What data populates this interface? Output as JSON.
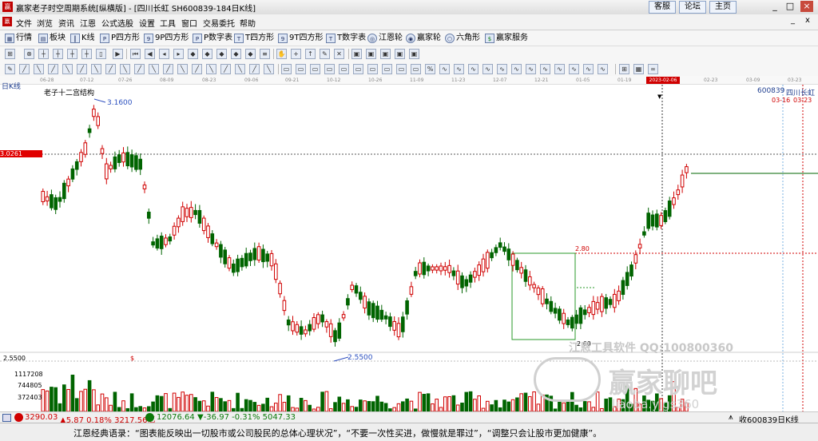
{
  "window": {
    "title": "赢家老子时空周期系统[纵横版] - [四川长虹  SH600839-184日K线]",
    "top_buttons": [
      "客服",
      "论坛",
      "主页"
    ],
    "win_controls": [
      "_",
      "□",
      "×"
    ],
    "sub_controls": [
      "_",
      "x"
    ]
  },
  "menu": [
    "文件",
    "浏览",
    "资讯",
    "江恩",
    "公式选股",
    "设置",
    "工具",
    "窗口",
    "交易委托",
    "帮助"
  ],
  "toolbar1": [
    "行情",
    "板块",
    "K线",
    "P四方形",
    "9P四方形",
    "P数字表",
    "T四方形",
    "9T四方形",
    "T数字表",
    "江恩轮",
    "赢家轮",
    "六角形",
    "赢家服务"
  ],
  "chart": {
    "period_label": "日K线",
    "structure_label": "老子十二宫结构",
    "stock_code": "600839",
    "stock_name": "四川长虹",
    "high_label": "3.1600",
    "low_label": "2.5500",
    "left_price_tag": "3.0261",
    "left_low_tag": "2.5500",
    "box_top_label": "2.80",
    "box_bottom_label": "2.60",
    "selected_date": "2023-02-06",
    "right_dates": [
      "03-16",
      "03-23"
    ],
    "dollar_mark": "$",
    "date_ticks": [
      "06-28",
      "07-12",
      "07-26",
      "08-09",
      "08-23",
      "09-06",
      "09-21",
      "10-12",
      "10-26",
      "11-09",
      "11-23",
      "12-07",
      "12-21",
      "01-05",
      "01-19",
      "2023-02-06",
      "02-23",
      "03-09",
      "03-23"
    ],
    "vol_ticks": [
      "1117208",
      "744805",
      "372403"
    ],
    "watermark1": "江恩工具软件  QQ:100800360",
    "watermark2": "赢家聊吧",
    "watermark3": "liaoba.yjgs360"
  },
  "status": {
    "sh": "3290.03",
    "sh_chg": "▲5.87 0.18% 3217.56亿",
    "sz": "12076.64",
    "sz_chg": "▼-36.97 -0.31% 5047.33",
    "right": "收600839日K线"
  },
  "quote": "江恩经典语录：“图表能反映出一切股市或公司股民的总体心理状况”，“不要一次性买进，做慢就是罪过”，“调整只会让股市更加健康”。",
  "colors": {
    "up": "#d00000",
    "down": "#006400",
    "accent": "#e00000"
  }
}
